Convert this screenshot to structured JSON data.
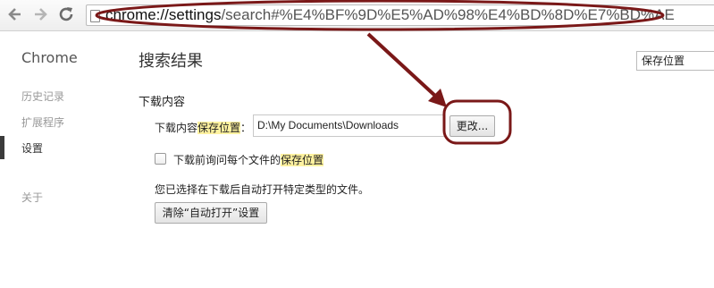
{
  "browser": {
    "url_host": "chrome://",
    "url_path_highlight": "settings",
    "url_rest": "/search#%E4%BF%9D%E5%AD%98%E4%BD%8D%E7%BD%AE"
  },
  "sidebar": {
    "title": "Chrome",
    "items": [
      {
        "label": "历史记录"
      },
      {
        "label": "扩展程序"
      },
      {
        "label": "设置"
      },
      {
        "label": "关于"
      }
    ]
  },
  "main": {
    "page_title": "搜索结果",
    "search_value": "保存位置",
    "downloads": {
      "section_title": "下载内容",
      "location_label_prefix": "下载内容",
      "location_label_highlight": "保存位置",
      "location_label_suffix": "：",
      "location_value": "D:\\My Documents\\Downloads",
      "change_button": "更改...",
      "ask_label_prefix": "下载前询问每个文件的",
      "ask_label_highlight": "保存位置",
      "ask_checked": false,
      "auto_open_info": "您已选择在下载后自动打开特定类型的文件。",
      "clear_auto_open_button": "清除“自动打开”设置"
    }
  },
  "annotation_color": "#7a1818",
  "highlight_color": "#fff2a0",
  "icons": [
    "back-icon",
    "forward-icon",
    "reload-icon",
    "page-icon"
  ]
}
